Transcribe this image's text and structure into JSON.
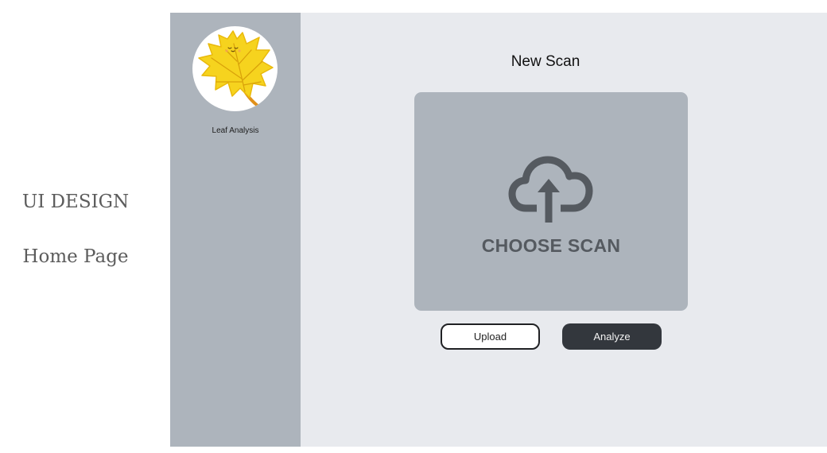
{
  "caption": {
    "line1": "UI DESIGN",
    "line2": "Home Page"
  },
  "sidebar": {
    "logo_icon": "maple-leaf-icon",
    "app_name": "Leaf Analysis"
  },
  "main": {
    "title": "New Scan",
    "dropzone": {
      "icon": "cloud-upload-icon",
      "label": "CHOOSE SCAN"
    },
    "buttons": {
      "upload": "Upload",
      "analyze": "Analyze"
    }
  },
  "colors": {
    "sidebar_bg": "#adb4bc",
    "main_bg": "#e8eaee",
    "dropzone_bg": "#adb4bc",
    "primary_button": "#33373d",
    "leaf_yellow": "#f6d31e"
  }
}
